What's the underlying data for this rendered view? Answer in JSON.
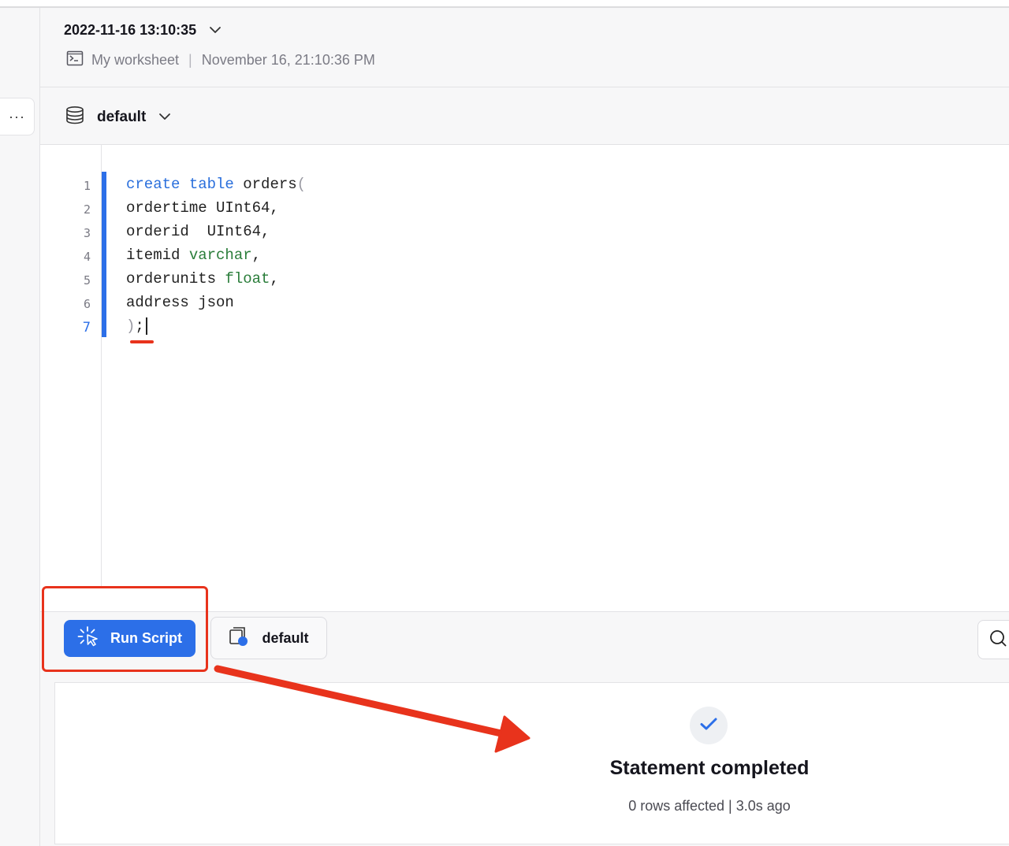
{
  "header": {
    "title": "2022-11-16 13:10:35",
    "worksheet_name": "My worksheet",
    "separator": "|",
    "timestamp": "November 16, 21:10:36 PM"
  },
  "database_selector": {
    "label": "default"
  },
  "more_menu": {
    "label": "···"
  },
  "editor": {
    "line_numbers": [
      "1",
      "2",
      "3",
      "4",
      "5",
      "6",
      "7"
    ],
    "lines": [
      {
        "parts": [
          [
            "create",
            "kw"
          ],
          [
            " ",
            ""
          ],
          [
            "table",
            "kw"
          ],
          [
            " orders",
            ""
          ],
          [
            "(",
            "pn"
          ]
        ]
      },
      {
        "parts": [
          [
            "ordertime UInt64,",
            ""
          ]
        ]
      },
      {
        "parts": [
          [
            "orderid  UInt64,",
            ""
          ]
        ]
      },
      {
        "parts": [
          [
            "itemid ",
            ""
          ],
          [
            "varchar",
            "ty"
          ],
          [
            ",",
            ""
          ]
        ]
      },
      {
        "parts": [
          [
            "orderunits ",
            ""
          ],
          [
            "float",
            "ty"
          ],
          [
            ",",
            ""
          ]
        ]
      },
      {
        "parts": [
          [
            "address json",
            ""
          ]
        ]
      },
      {
        "parts": [
          [
            ")",
            "pn"
          ],
          [
            ";",
            ""
          ]
        ]
      }
    ]
  },
  "toolbar": {
    "run_label": "Run Script",
    "warehouse_label": "default"
  },
  "result": {
    "title": "Statement completed",
    "rows_affected": "0 rows affected",
    "separator": "|",
    "elapsed": "3.0s ago"
  },
  "colors": {
    "accent": "#2c6fe8",
    "annotation": "#e8331c"
  },
  "icons": {
    "title_dropdown": "chevron-down-icon",
    "worksheet": "terminal-icon",
    "database": "database-icon",
    "run": "spark-cursor-icon",
    "warehouse": "warehouse-icon",
    "search": "search-icon",
    "status": "check-icon"
  }
}
